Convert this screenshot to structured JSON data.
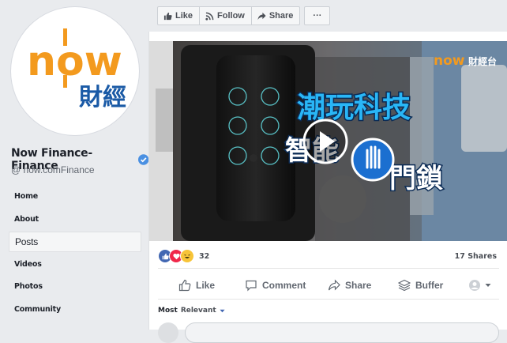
{
  "page": {
    "name": "Now  Finance-Finance",
    "handle": "@ now.comFinance",
    "logo_text_top": "now",
    "logo_text_bottom": "財經"
  },
  "nav": {
    "items": [
      {
        "label": "Home"
      },
      {
        "label": "About"
      },
      {
        "label": "Posts"
      },
      {
        "label": "Videos"
      },
      {
        "label": "Photos"
      },
      {
        "label": "Community"
      }
    ]
  },
  "toolbar": {
    "like": "Like",
    "follow": "Follow",
    "share": "Share",
    "more": "···"
  },
  "video": {
    "title_line1": "潮玩科技",
    "title_line2_left": "智能",
    "title_line2_right": "門鎖",
    "watermark_now": "now",
    "watermark_cn": "財經台"
  },
  "post": {
    "reaction_count": "32",
    "shares": "17 Shares",
    "actions": {
      "like": "Like",
      "comment": "Comment",
      "share": "Share",
      "buffer": "Buffer"
    },
    "sort_prefix": "Most",
    "sort_value": "Relevant"
  },
  "colors": {
    "brand_orange": "#f39a1e",
    "brand_blue": "#1a5aa6",
    "fb_blue": "#4267b2",
    "title_blue": "#29b6f6"
  }
}
